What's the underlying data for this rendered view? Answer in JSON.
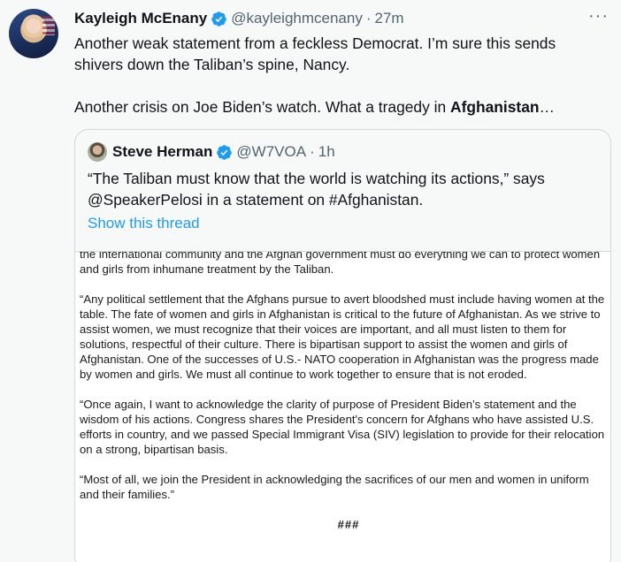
{
  "tweet": {
    "author_name": "Kayleigh McEnany",
    "handle": "@kayleighmcenany",
    "separator": "·",
    "time": "27m",
    "more_icon": "···",
    "text_line1": "Another weak statement from a feckless Democrat. I’m sure this sends shivers down the Taliban’s spine, Nancy.",
    "text_line2_prefix": "Another crisis on Joe Biden’s watch. What a tragedy in ",
    "text_line2_bold": "Afghanistan",
    "text_line2_suffix": "…",
    "verified_color": "#1d9bf0"
  },
  "quote": {
    "author_name": "Steve Herman",
    "handle": "@W7VOA",
    "separator": "·",
    "time": "1h",
    "text": "“The Taliban must know that the world is watching its actions,” says @SpeakerPelosi in a statement on #Afghanistan.",
    "show_thread": "Show this thread",
    "link_color": "#1d9bf0"
  },
  "document": {
    "para1": "the international community and the Afghan government must do everything we can to protect women and girls from inhumane treatment by the Taliban.",
    "para2": "“Any political settlement that the Afghans pursue to avert bloodshed must include having women at the table.  The fate of women and girls in Afghanistan is critical to the future of Afghanistan.  As we strive to assist women, we must recognize that their voices are important, and all must listen to them for solutions, respectful of their culture.  There is bipartisan support to assist the women and girls of Afghanistan.  One of the successes of U.S.- NATO cooperation in Afghanistan was the progress made by women and girls.  We must all continue to work together to ensure that is not eroded.",
    "para3": "“Once again, I want to acknowledge the clarity of purpose of President Biden’s statement and the wisdom of his actions.  Congress shares the President's concern for Afghans who have assisted U.S. efforts in country, and we passed Special Immigrant Visa (SIV) legislation to provide for their relocation on a strong, bipartisan basis.",
    "para4": "“Most of all, we join the President in acknowledging the sacrifices of our men and women in uniform and their families.”",
    "end_mark": "###"
  }
}
